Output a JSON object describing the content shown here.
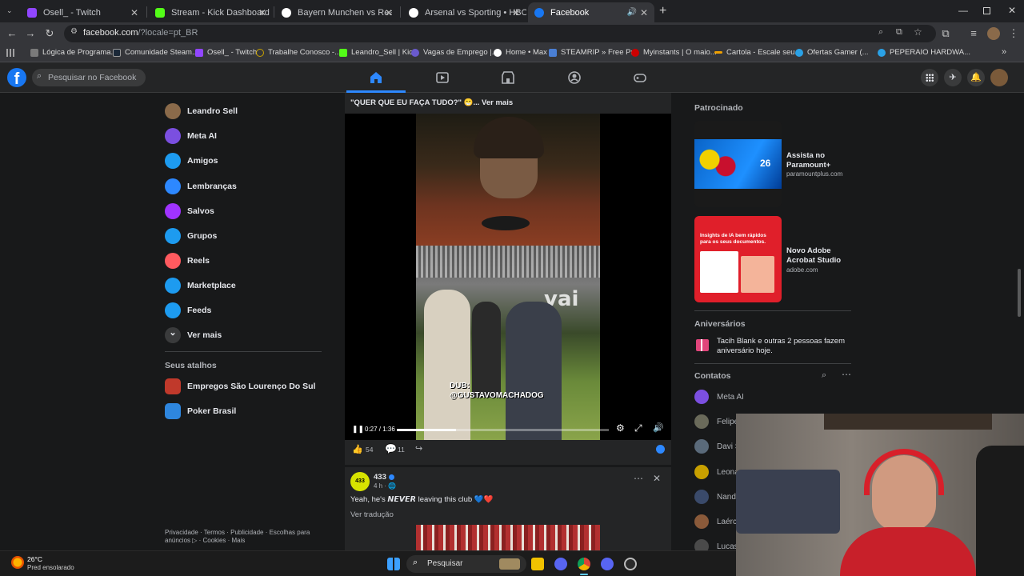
{
  "browser": {
    "tabs": [
      {
        "title": "Osell_ - Twitch",
        "color": "#9146ff"
      },
      {
        "title": "Stream - Kick Dashboard",
        "color": "#53fc18"
      },
      {
        "title": "Bayern Munchen vs Real Madri",
        "color": "#e8e8e8"
      },
      {
        "title": "Arsenal vs Sporting • HBO Max",
        "color": "#e8e8e8"
      },
      {
        "title": "Facebook",
        "color": "#1877f2"
      }
    ],
    "url_main": "facebook.com",
    "url_rest": "/?locale=pt_BR",
    "bookmarks": [
      {
        "label": "Lógica de Programa...",
        "color": "#7a7a7a"
      },
      {
        "label": "Comunidade Steam...",
        "color": "#1b2838"
      },
      {
        "label": "Osell_ - Twitch",
        "color": "#9146ff"
      },
      {
        "label": "Trabalhe Conosco -...",
        "color": "#c9a200"
      },
      {
        "label": "Leandro_Sell | Kick",
        "color": "#53fc18"
      },
      {
        "label": "Vagas de Emprego |...",
        "color": "#6a5acd"
      },
      {
        "label": "Home • Max",
        "color": "#ffffff"
      },
      {
        "label": "STEAMRIP » Free Pr...",
        "color": "#4a7fd4"
      },
      {
        "label": "Myinstants | O maio...",
        "color": "#cc0000"
      },
      {
        "label": "Cartola - Escale seu...",
        "color": "#f0a000"
      },
      {
        "label": "Ofertas Gamer (...",
        "color": "#2aa1e6"
      },
      {
        "label": "PEPERAIO HARDWA...",
        "color": "#2aa1e6"
      }
    ]
  },
  "fb": {
    "search_placeholder": "Pesquisar no Facebook",
    "sidebar": [
      {
        "label": "Leandro Sell",
        "color": "#8a6a4a"
      },
      {
        "label": "Meta AI",
        "color": "#7b4fe0"
      },
      {
        "label": "Amigos",
        "color": "#1d9bf0"
      },
      {
        "label": "Lembranças",
        "color": "#2d88ff"
      },
      {
        "label": "Salvos",
        "color": "#a033ff"
      },
      {
        "label": "Grupos",
        "color": "#1d9bf0"
      },
      {
        "label": "Reels",
        "color": "#ff5a5f"
      },
      {
        "label": "Marketplace",
        "color": "#1d9bf0"
      },
      {
        "label": "Feeds",
        "color": "#1d9bf0"
      },
      {
        "label": "Ver mais",
        "color": "#3a3b3c"
      }
    ],
    "shortcuts_title": "Seus atalhos",
    "shortcuts": [
      {
        "label": "Empregos São Lourenço Do Sul",
        "color": "#c0392b"
      },
      {
        "label": "Poker Brasil",
        "color": "#2e86de"
      }
    ],
    "footer_line1": "Privacidade · Termos · Publicidade · Escolhas para",
    "footer_line2": "anúncios ▷ · Cookies · Mais",
    "post1": {
      "caption": "\"QUER QUE EU FAÇA TUDO?\" 😁... Ver mais",
      "overlay_dub": "DUB:",
      "overlay_handle": "@GUSTAVOMACHADOG",
      "time": "0:27 / 1:36",
      "progress": 0.28,
      "likes": "54",
      "comments": "11"
    },
    "post2": {
      "author": "433",
      "meta": "4 h · 🌐",
      "text": "Yeah, he's 𝙉𝙀𝙑𝙀𝙍 leaving this club 💙❤️",
      "translate": "Ver tradução"
    },
    "sponsored_title": "Patrocinado",
    "ads": [
      {
        "title": "Assista no Paramount+",
        "domain": "paramountplus.com"
      },
      {
        "title": "Novo Adobe Acrobat Studio",
        "domain": "adobe.com"
      }
    ],
    "ad1_badge": "26",
    "ad2_headline": "Insights de IA bem rápidos para os seus documentos.",
    "birthdays_title": "Aniversários",
    "birthday_text": "Tacih Blank e outras 2 pessoas fazem aniversário hoje.",
    "contacts_title": "Contatos",
    "contacts": [
      "Meta AI",
      "Felipe",
      "Davi S",
      "Leona",
      "Nand",
      "Laérc",
      "Lucas"
    ]
  },
  "taskbar": {
    "temp": "26°C",
    "weather": "Pred ensolarado",
    "search": "Pesquisar"
  }
}
